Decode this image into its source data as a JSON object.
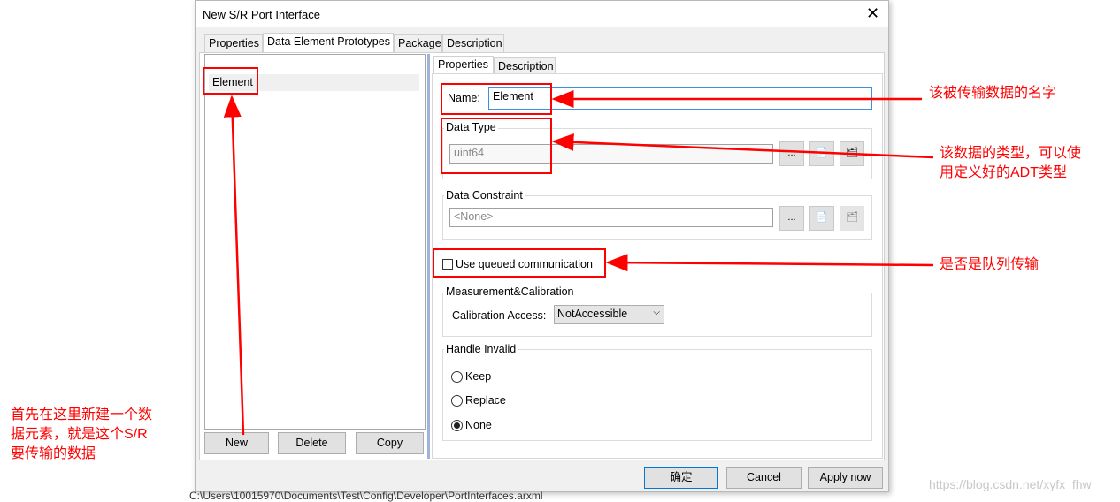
{
  "dialog": {
    "title": "New S/R Port Interface",
    "close_icon": "close-icon",
    "tabs": [
      "Properties",
      "Data Element Prototypes",
      "Package",
      "Description"
    ],
    "list": {
      "items": [
        "Element"
      ],
      "buttons": {
        "new": "New",
        "delete": "Delete",
        "copy": "Copy"
      }
    },
    "detail": {
      "tabs": [
        "Properties",
        "Description"
      ],
      "name_label": "Name:",
      "name_value": "Element",
      "data_type": {
        "label": "Data Type",
        "value": "uint64",
        "browse": "..."
      },
      "data_constraint": {
        "label": "Data Constraint",
        "value": "<None>",
        "browse": "..."
      },
      "queued": {
        "label": "Use queued communication",
        "checked": false
      },
      "measurement": {
        "label": "Measurement&Calibration",
        "access_label": "Calibration Access:",
        "access_value": "NotAccessible"
      },
      "handle_invalid": {
        "label": "Handle Invalid",
        "options": [
          "Keep",
          "Replace",
          "None"
        ],
        "selected": "None"
      }
    },
    "footer": {
      "ok": "确定",
      "cancel": "Cancel",
      "apply": "Apply now"
    }
  },
  "background": {
    "path": "C:\\Users\\10015970\\Documents\\Test\\Config\\Developer\\PortInterfaces.arxml"
  },
  "annotations": {
    "name": "该被传输数据的名字",
    "type_line1": "该数据的类型，可以使",
    "type_line2": "用定义好的ADT类型",
    "queued": "是否是队列传输",
    "new_line1": "首先在这里新建一个数",
    "new_line2": "据元素，就是这个S/R",
    "new_line3": "要传输的数据",
    "color": "#ff0000"
  },
  "watermark": "https://blog.csdn.net/xyfx_fhw"
}
